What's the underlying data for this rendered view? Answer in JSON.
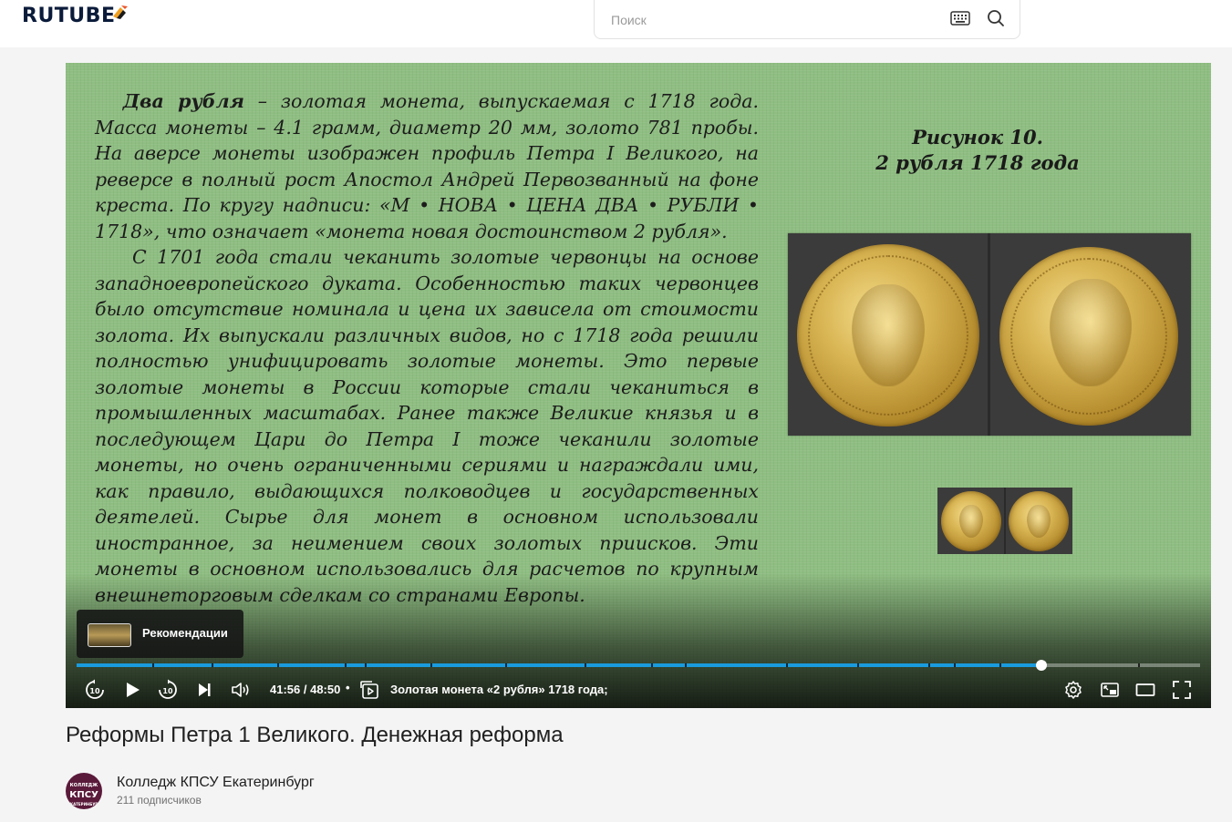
{
  "header": {
    "logo": "RUTUBE",
    "search_placeholder": "Поиск"
  },
  "slide": {
    "paragraph1_lead": "Два рубля",
    "paragraph1": " – золотая монета, выпускаемая с 1718 года. Масса монеты – 4.1 грамм, диаметр 20 мм, золото 781 пробы. На аверсе монеты изображен профиль Петра I Великого, на реверсе в полный рост Апостол Андрей Первозванный на фоне креста. По кругу надписи: «М • НОВА • ЦЕНА ДВА • РУБЛИ • 1718», что означает «монета новая достоинством 2 рубля».",
    "paragraph2": "С 1701 года стали чеканить золотые червонцы на основе западноевропейского дуката. Особенностью таких червонцев было отсутствие номинала и цена их зависела от стоимости золота. Их выпускали различных видов, но с 1718 года решили полностью унифицировать золотые монеты. Это первые золотые монеты в России которые стали чеканиться в промышленных масштабах. Ранее также Великие князья и в последующем Цари до Петра I тоже чеканили золотые монеты, но очень ограниченными сериями и награждали ими, как правило, выдающихся полководцев и государственных деятелей. Сырье для монет в основном использовали иностранное, за неимением своих золотых приисков. Эти монеты в основном использовались для расчетов по крупным внешнеторговым сделкам со странами Европы.",
    "figure_caption_line1": "Рисунок 10.",
    "figure_caption_line2": "2 рубля 1718 года"
  },
  "player": {
    "recommendations_label": "Рекомендации",
    "current_time": "41:56",
    "duration": "48:50",
    "time_display": "41:56 / 48:50",
    "separator": "•",
    "chapter_title": "Золотая монета «2 рубля» 1718 года;",
    "progress_fraction": 0.8587
  },
  "video": {
    "title": "Реформы Петра 1 Великого. Денежная реформа"
  },
  "channel": {
    "name": "Колледж КПСУ Екатеринбург",
    "subscribers": "211 подписчиков",
    "avatar_line1": "КОЛЛЕДЖ",
    "avatar_line2": "КПСУ",
    "avatar_line3": "ЕКАТЕРИНБУРГ"
  },
  "colors": {
    "accent_progress": "#1a9bdd",
    "slide_background": "#8fbe82",
    "page_background": "#f4f4f4"
  },
  "icons": [
    "replay-10-icon",
    "play-icon",
    "forward-10-icon",
    "next-icon",
    "volume-icon",
    "chapters-icon",
    "settings-icon",
    "miniplayer-icon",
    "theater-mode-icon",
    "fullscreen-icon",
    "keyboard-icon",
    "search-icon"
  ]
}
